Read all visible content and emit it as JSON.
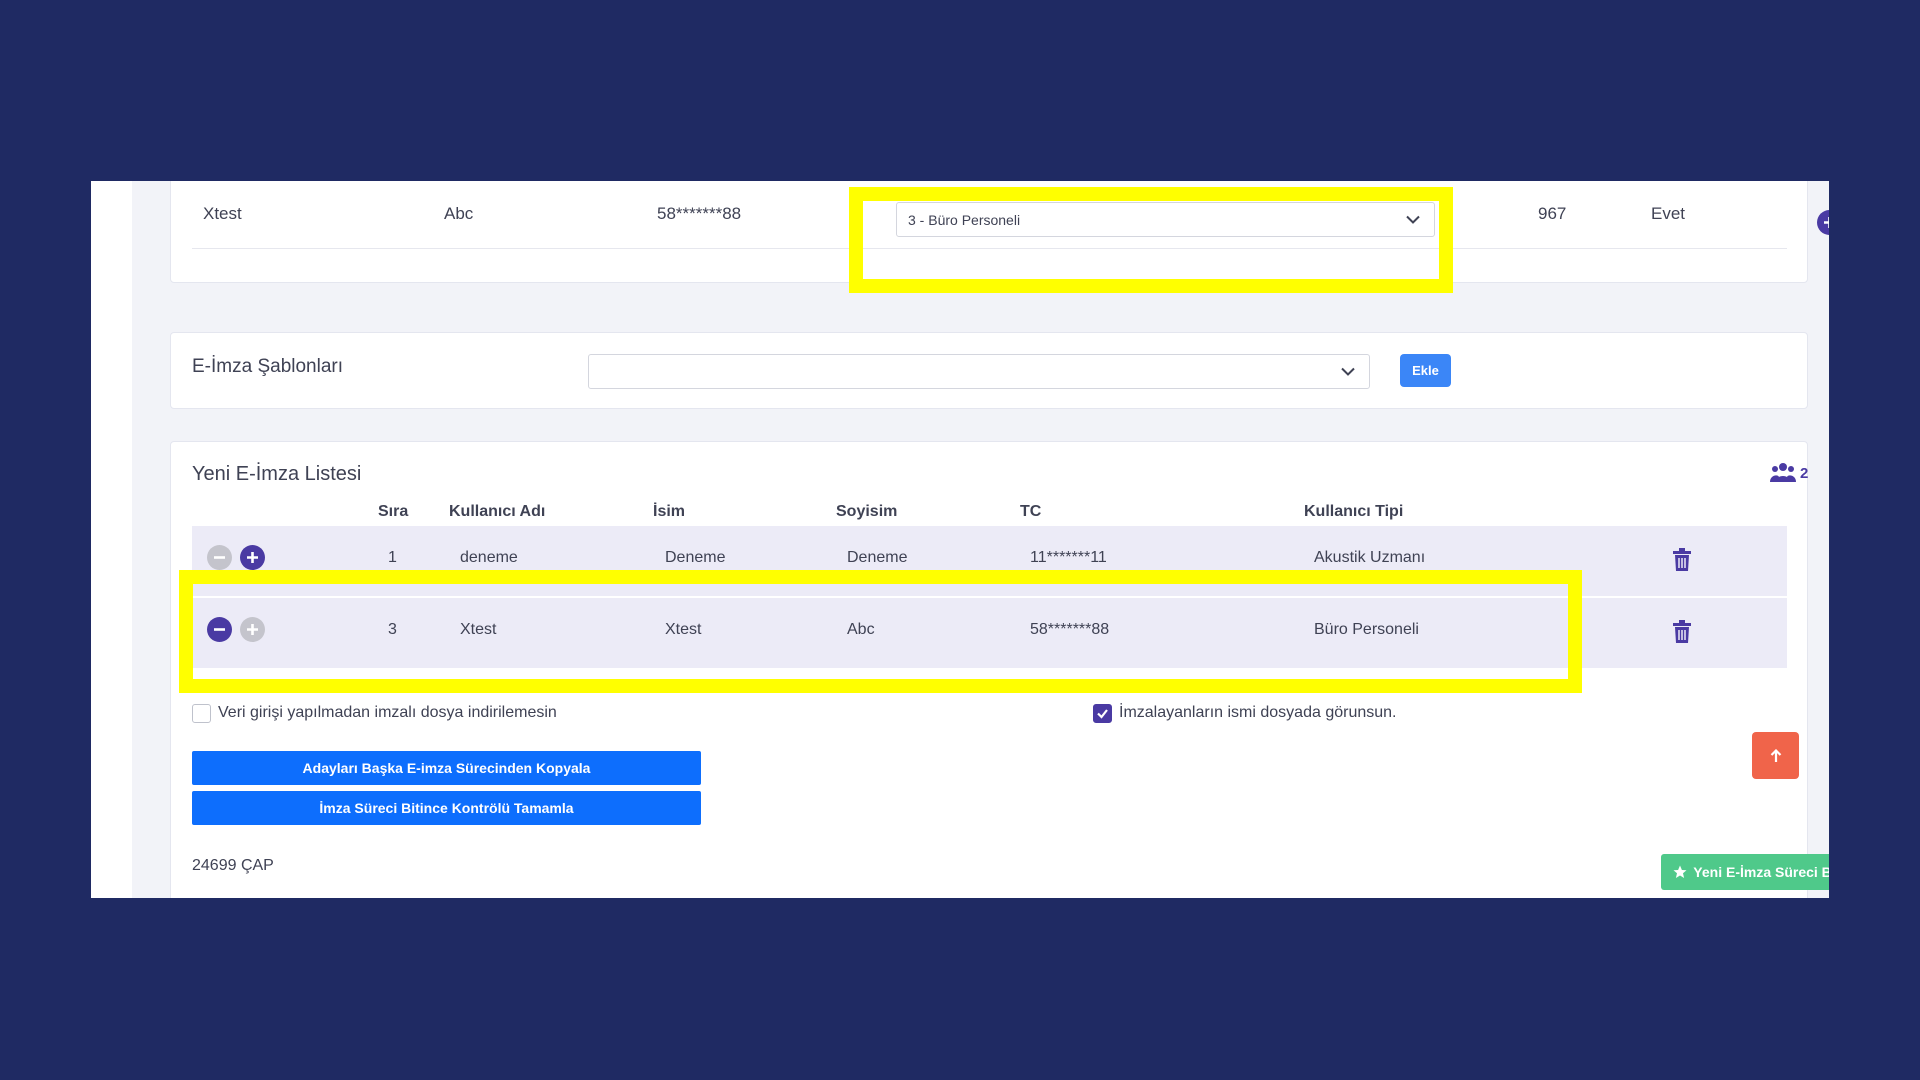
{
  "top_row": {
    "username": "Xtest",
    "surname": "Abc",
    "tc": "58*******88",
    "user_type_select": "3 - Büro Personeli",
    "number": "967",
    "flag": "Evet"
  },
  "templates": {
    "label": "E-İmza Şablonları",
    "select_value": "",
    "add_button": "Ekle"
  },
  "list": {
    "title": "Yeni E-İmza Listesi",
    "group_count": "2",
    "columns": [
      "Sıra",
      "Kullanıcı Adı",
      "İsim",
      "Soyisim",
      "TC",
      "Kullanıcı Tipi"
    ],
    "rows": [
      {
        "sira": "1",
        "username": "deneme",
        "name": "Deneme",
        "surname": "Deneme",
        "tc": "11*******11",
        "type": "Akustik Uzmanı"
      },
      {
        "sira": "3",
        "username": "Xtest",
        "name": "Xtest",
        "surname": "Abc",
        "tc": "58*******88",
        "type": "Büro Personeli"
      }
    ]
  },
  "options": {
    "no_download_label": "Veri girişi yapılmadan imzalı dosya indirilemesin",
    "no_download_checked": false,
    "show_names_label": "İmzalayanların ismi dosyada görunsun.",
    "show_names_checked": true
  },
  "actions": {
    "copy_candidates": "Adayları Başka E-imza Sürecinden Kopyala",
    "complete_controlled": "İmza Süreci Bitince Kontrölü Tamamla",
    "start_new": "Yeni E-İmza Süreci Başlat"
  },
  "footer_code": "24699 ÇAP",
  "colors": {
    "background": "#1f2a63",
    "accent_purple": "#4a3aa3",
    "primary_blue": "#0d6efd",
    "success_green": "#4fc98a",
    "highlight": "#ffff00",
    "scroll_top": "#f0644a"
  }
}
